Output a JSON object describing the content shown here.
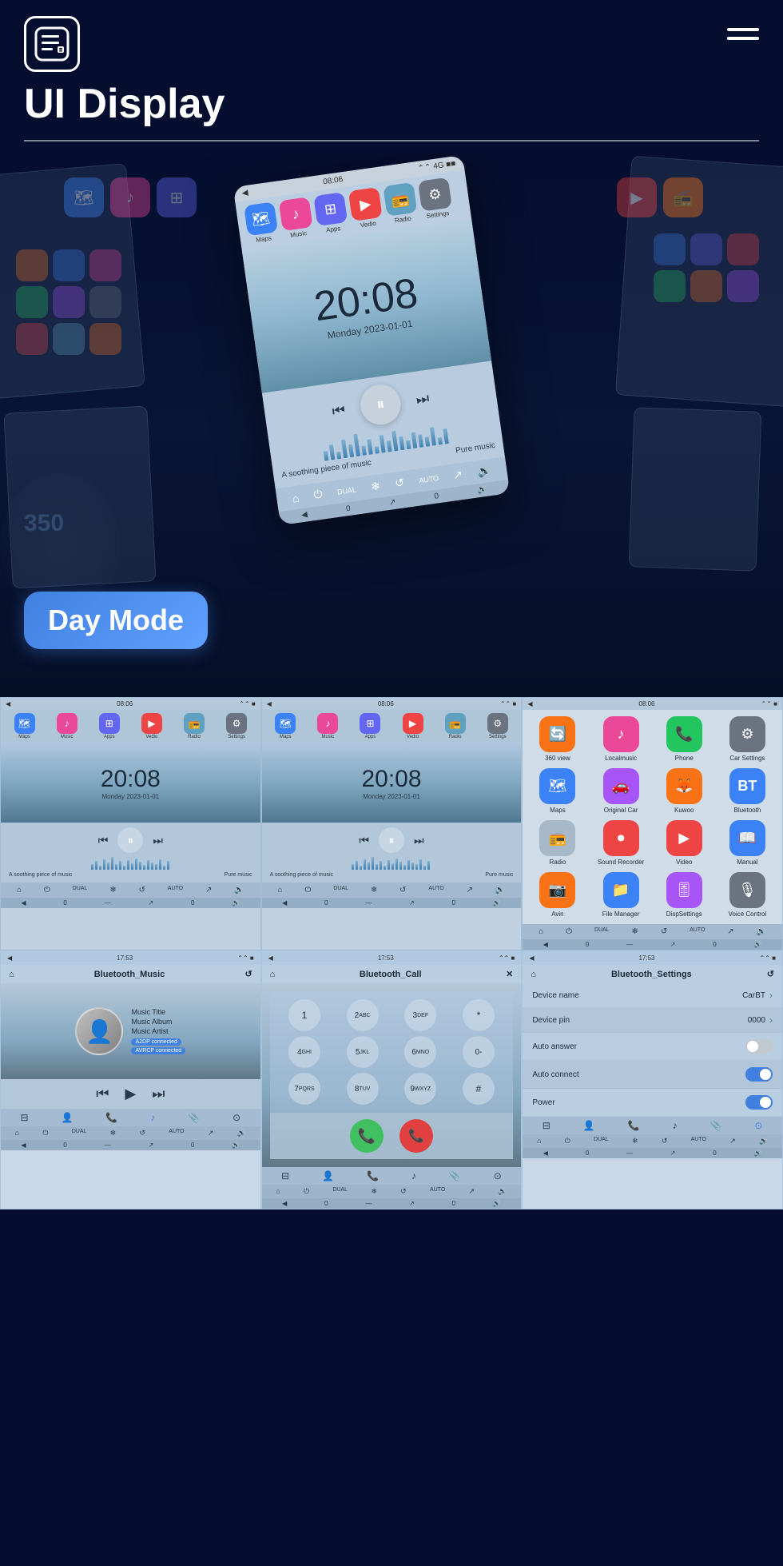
{
  "header": {
    "title": "UI Display",
    "logo_alt": "menu-list-icon",
    "hamburger_alt": "hamburger-menu-icon"
  },
  "dayMode": {
    "label": "Day Mode"
  },
  "mainPhone": {
    "time": "20:08",
    "date": "Monday  2023-01-01",
    "musicText": "A soothing piece of music",
    "pureMusic": "Pure music",
    "statusTime": "08:06",
    "apps": [
      {
        "label": "Maps",
        "color": "#3b82f6",
        "icon": "🗺"
      },
      {
        "label": "Music",
        "color": "#ec4899",
        "icon": "♪"
      },
      {
        "label": "Apps",
        "color": "#6366f1",
        "icon": "⊞"
      },
      {
        "label": "Vedio",
        "color": "#ef4444",
        "icon": "▶"
      },
      {
        "label": "Radio",
        "color": "#60a0c0",
        "icon": "📻"
      },
      {
        "label": "Settings",
        "color": "#6b7280",
        "icon": "⚙"
      }
    ]
  },
  "miniPhones": [
    {
      "statusTime": "08:06",
      "time": "20:08",
      "date": "Monday  2023-01-01",
      "musicText": "A soothing piece of music",
      "pureMusic": "Pure music"
    },
    {
      "statusTime": "08:06",
      "time": "20:08",
      "date": "Monday  2023-01-01",
      "musicText": "A soothing piece of music",
      "pureMusic": "Pure music"
    }
  ],
  "appGrid": {
    "statusTime": "08:06",
    "apps": [
      {
        "label": "360 view",
        "icon": "🔄",
        "color": "#f97316"
      },
      {
        "label": "Localmusic",
        "icon": "♪",
        "color": "#ec4899"
      },
      {
        "label": "Phone",
        "icon": "📞",
        "color": "#22c55e"
      },
      {
        "label": "Car Settings",
        "icon": "⚙",
        "color": "#6b7280"
      },
      {
        "label": "Maps",
        "icon": "🗺",
        "color": "#3b82f6"
      },
      {
        "label": "Original Car",
        "icon": "🚗",
        "color": "#a855f7"
      },
      {
        "label": "Kuwoo",
        "icon": "🦊",
        "color": "#f97316"
      },
      {
        "label": "Bluetooth",
        "icon": "⬡",
        "color": "#3b82f6"
      },
      {
        "label": "Radio",
        "icon": "📻",
        "color": "#607080"
      },
      {
        "label": "Sound Recorder",
        "icon": "⏺",
        "color": "#ef4444"
      },
      {
        "label": "Video",
        "icon": "▶",
        "color": "#ef4444"
      },
      {
        "label": "Manual",
        "icon": "📖",
        "color": "#3b82f6"
      },
      {
        "label": "Avin",
        "icon": "📷",
        "color": "#f97316"
      },
      {
        "label": "File Manager",
        "icon": "📁",
        "color": "#3b82f6"
      },
      {
        "label": "DispSettings",
        "icon": "🎚",
        "color": "#a855f7"
      },
      {
        "label": "Voice Control",
        "icon": "🎙",
        "color": "#6b7280"
      }
    ]
  },
  "btPhones": [
    {
      "statusTime": "17:53",
      "title": "Bluetooth_Music",
      "musicTitle": "Music Title",
      "musicAlbum": "Music Album",
      "musicArtist": "Music Artist",
      "badge1": "A2DP connected",
      "badge2": "AVRCP connected"
    },
    {
      "statusTime": "17:53",
      "title": "Bluetooth_Call",
      "dialKeys": [
        "1",
        "2 ABC",
        "3 DEF",
        "*",
        "4 GHI",
        "5 JKL",
        "6 MNO",
        "0 -",
        "7 PQRS",
        "8 TUV",
        "9 WXYZ",
        "#"
      ]
    },
    {
      "statusTime": "17:53",
      "title": "Bluetooth_Settings",
      "settings": [
        {
          "label": "Device name",
          "value": "CarBT",
          "type": "chevron"
        },
        {
          "label": "Device pin",
          "value": "0000",
          "type": "chevron"
        },
        {
          "label": "Auto answer",
          "value": "",
          "type": "toggle-off"
        },
        {
          "label": "Auto connect",
          "value": "",
          "type": "toggle-on"
        },
        {
          "label": "Power",
          "value": "",
          "type": "toggle-on"
        }
      ]
    }
  ],
  "bottomNavIcons": [
    "⊟",
    "👤",
    "📞",
    "♪",
    "📎",
    "⊙"
  ],
  "controlIcons": [
    "⌂",
    "⏻",
    "DUAL",
    "❄",
    "↺",
    "AUTO",
    "↗",
    "🔊"
  ],
  "statusIcons": [
    "◀",
    "↖",
    "0",
    "—",
    "↗",
    "0",
    "🔊"
  ],
  "waveHeights": [
    8,
    12,
    6,
    15,
    10,
    18,
    8,
    12,
    6,
    14,
    9,
    16,
    11,
    7,
    13,
    10,
    8,
    15,
    6,
    12
  ],
  "colors": {
    "primary": "#050e2e",
    "accent": "#4080e0",
    "dayModeBg": "linear-gradient(135deg, #4080e0, #60a0ff)"
  }
}
